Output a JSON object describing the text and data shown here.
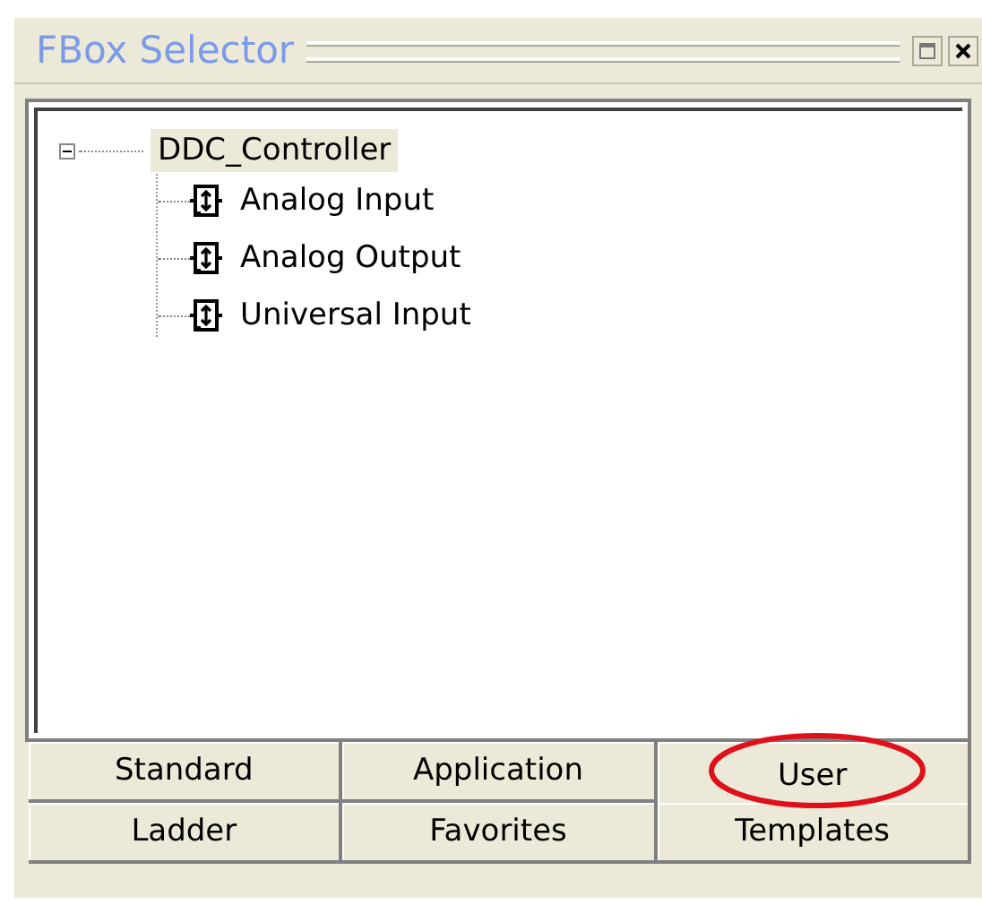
{
  "window": {
    "title": "FBox Selector"
  },
  "tree": [
    {
      "label": "DDC_Controller",
      "expanded": true,
      "selected": true,
      "children": [
        {
          "label": "Analog Input",
          "selected": false
        },
        {
          "label": "Analog Output",
          "selected": false
        },
        {
          "label": "Universal Input",
          "selected": false
        }
      ]
    }
  ],
  "tab_rows": [
    [
      {
        "label": "Standard",
        "selected": false
      },
      {
        "label": "Application",
        "selected": false
      },
      {
        "label": "User",
        "selected": true
      }
    ],
    [
      {
        "label": "Ladder",
        "selected": false
      },
      {
        "label": "Favorites",
        "selected": false
      },
      {
        "label": "Templates",
        "selected": false
      }
    ]
  ]
}
